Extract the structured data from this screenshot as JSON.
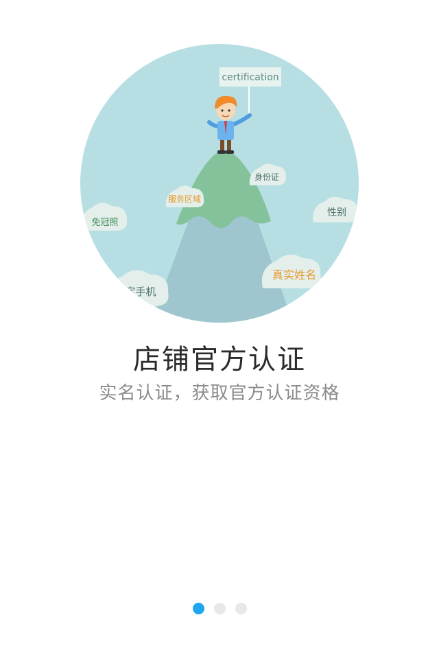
{
  "illustration": {
    "flag_text": "certification",
    "clouds": {
      "id_card": "身份证",
      "service_area": "服务区域",
      "no_hat_photo": "免冠照",
      "gender": "性别",
      "real_name": "真实姓名",
      "phone": "定手机"
    },
    "colors": {
      "circle_bg": "#b7dfe3",
      "mountain_top": "#84c29b",
      "mountain_base": "#9fc6ce",
      "cloud": "#e4efec",
      "cloud_text_green": "#3d8a57",
      "cloud_text_orange": "#e79a2e"
    }
  },
  "onboarding": {
    "title": "店铺官方认证",
    "subtitle": "实名认证，获取官方认证资格"
  },
  "pagination": {
    "total": 3,
    "active_index": 1,
    "active_color": "#1ea7f0",
    "inactive_color": "#e8e8e8"
  }
}
